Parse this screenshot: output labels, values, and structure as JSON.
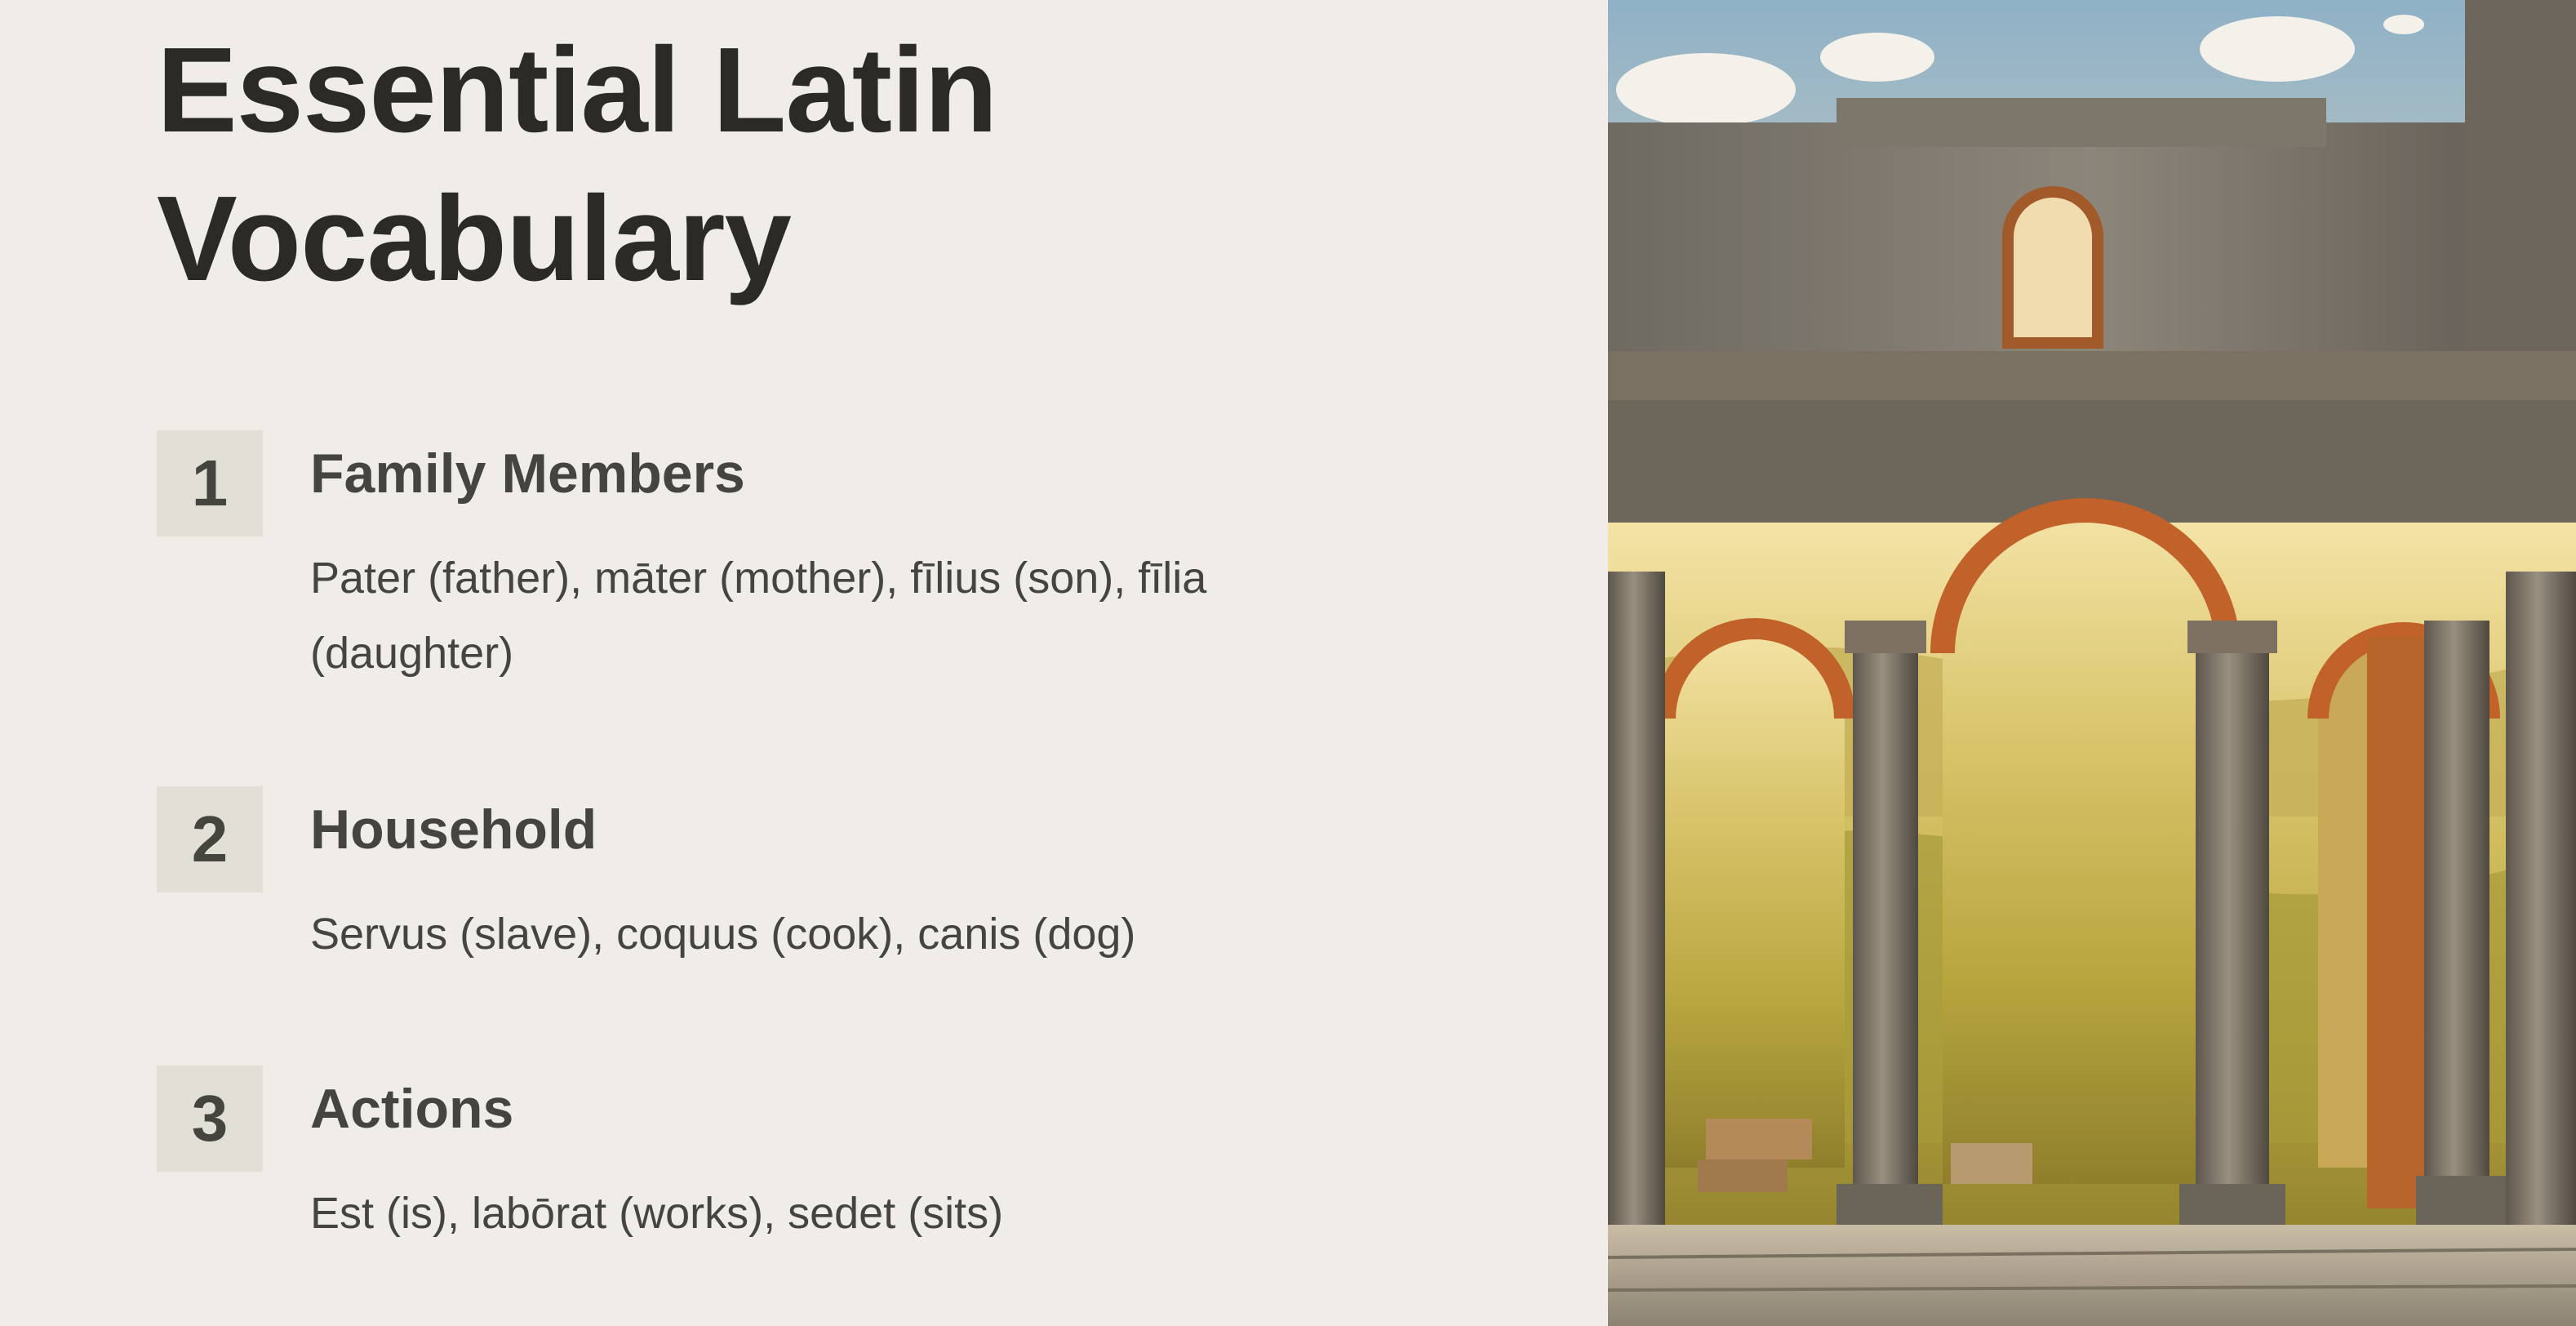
{
  "title": "Essential Latin Vocabulary",
  "items": [
    {
      "number": "1",
      "heading": "Family Members",
      "description": "Pater (father), māter (mother), fīlius (son), fīlia (daughter)"
    },
    {
      "number": "2",
      "heading": "Household",
      "description": "Servus (slave), coquus (cook), canis (dog)"
    },
    {
      "number": "3",
      "heading": "Actions",
      "description": "Est (is), labōrat (works), sedet (sits)"
    }
  ],
  "image": {
    "icon": "roman-arch-ruins-image"
  },
  "colors": {
    "background": "#f0ede9",
    "title": "#2b2a26",
    "text": "#45443f",
    "number_box": "#e2e0d6"
  }
}
